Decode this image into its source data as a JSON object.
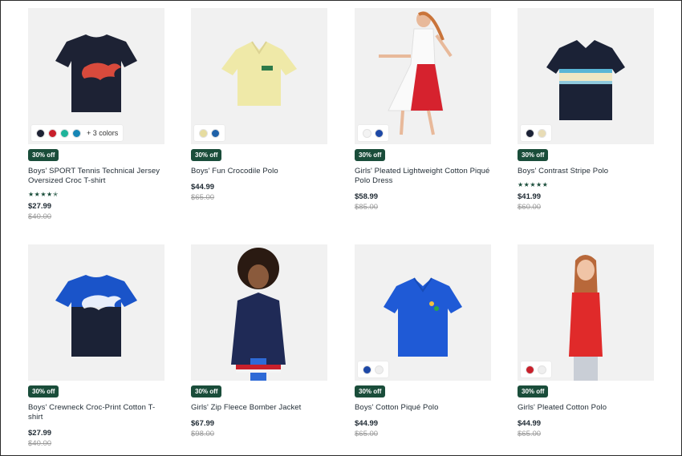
{
  "products": [
    {
      "badge": "30% off",
      "name": "Boys' SPORT Tennis Technical Jersey Oversized Croc T-shirt",
      "rating_stars": "★★★★✭",
      "price": "$27.99",
      "old_price": "$40.00",
      "swatches": [
        "#1d2234",
        "#c8202b",
        "#1fb39a",
        "#1786b5"
      ],
      "more_colors": "+ 3 colors"
    },
    {
      "badge": "30% off",
      "name": "Boys' Fun Crocodile Polo",
      "price": "$44.99",
      "old_price": "$65.00",
      "swatches": [
        "#e6dca0",
        "#1f61a8"
      ]
    },
    {
      "badge": "30% off",
      "name": "Girls' Pleated Lightweight Cotton Piqué Polo Dress",
      "price": "$58.99",
      "old_price": "$85.00",
      "swatches": [
        "#f3f3f3",
        "#1d48a6"
      ]
    },
    {
      "badge": "30% off",
      "name": "Boys' Contrast Stripe Polo",
      "rating_stars": "★★★★★",
      "price": "$41.99",
      "old_price": "$60.00",
      "swatches": [
        "#1b2236",
        "#e8dcb5"
      ]
    },
    {
      "badge": "30% off",
      "name": "Boys' Crewneck Croc-Print Cotton T-shirt",
      "price": "$27.99",
      "old_price": "$40.00"
    },
    {
      "badge": "30% off",
      "name": "Girls' Zip Fleece Bomber Jacket",
      "price": "$67.99",
      "old_price": "$98.00"
    },
    {
      "badge": "30% off",
      "name": "Boys' Cotton Piqué Polo",
      "price": "$44.99",
      "old_price": "$65.00",
      "swatches": [
        "#1d48a6",
        "#efefef"
      ]
    },
    {
      "badge": "30% off",
      "name": "Girls' Pleated Cotton Polo",
      "price": "$44.99",
      "old_price": "$65.00",
      "swatches": [
        "#c8202b",
        "#efefef"
      ]
    }
  ]
}
